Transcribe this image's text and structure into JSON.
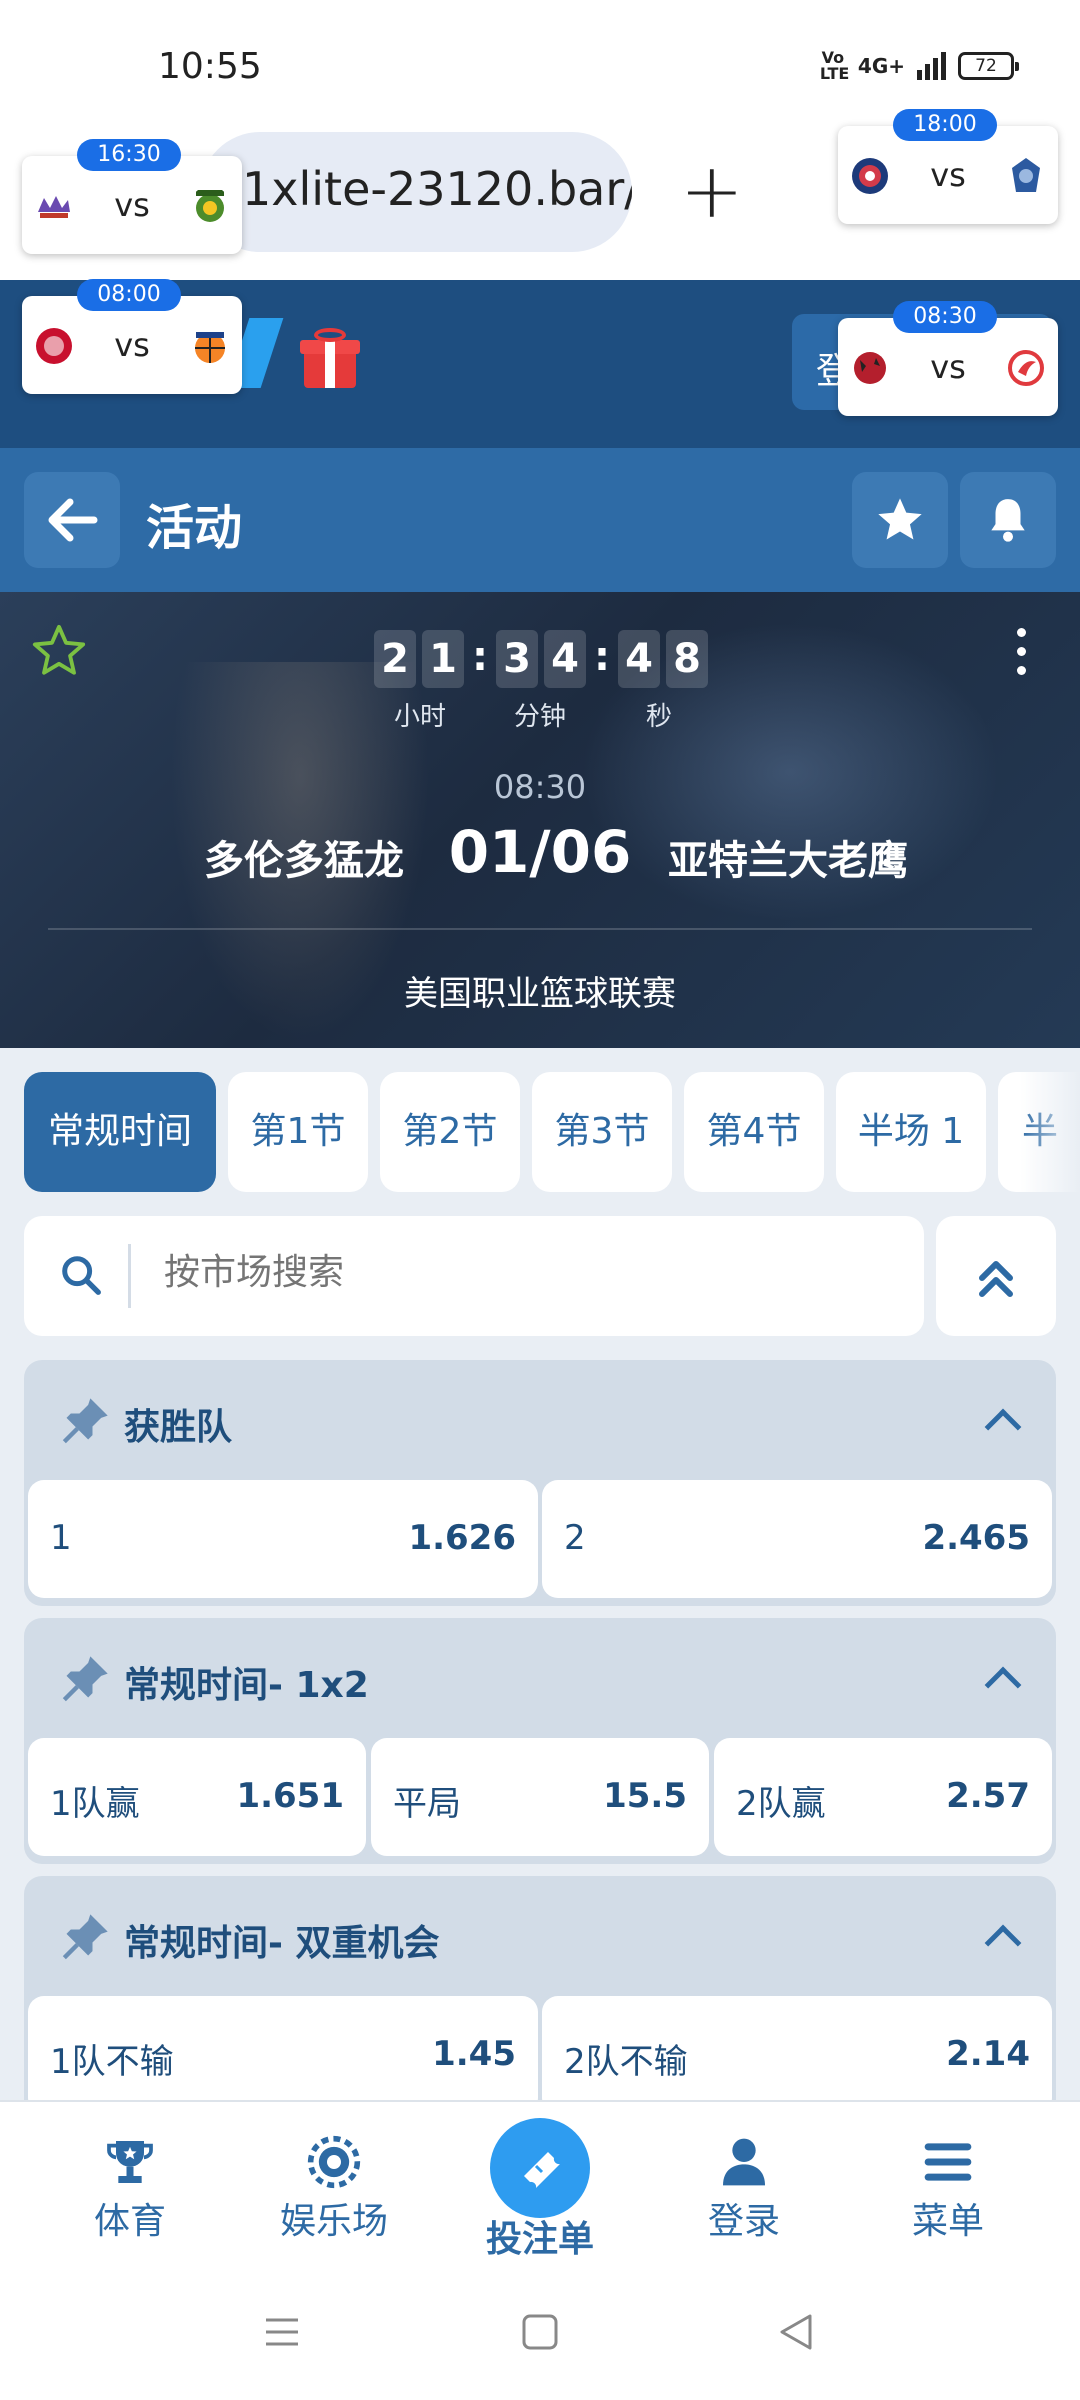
{
  "status_bar": {
    "time": "10:55",
    "volte": "Vo LTE",
    "network": "4G+",
    "battery": "72"
  },
  "browser": {
    "url": "1xlite-23120.bar/",
    "new_tab_label": "+"
  },
  "header": {
    "login_label": "登"
  },
  "match_popups": [
    {
      "time": "16:30",
      "vs": "vs",
      "home_logo": "sacramento-kings-logo",
      "away_logo": "phoenix-suns-logo"
    },
    {
      "time": "18:00",
      "vs": "vs",
      "home_logo": "team-logo-red-blue",
      "away_logo": "team-logo-blue"
    },
    {
      "time": "08:00",
      "vs": "vs",
      "home_logo": "team-logo-red",
      "away_logo": "new-york-knicks-logo"
    },
    {
      "time": "08:30",
      "vs": "vs",
      "home_logo": "toronto-raptors-logo",
      "away_logo": "atlanta-hawks-logo"
    }
  ],
  "activity_bar": {
    "title": "活动"
  },
  "scoreboard": {
    "countdown": {
      "hours": [
        "2",
        "1"
      ],
      "minutes": [
        "3",
        "4"
      ],
      "seconds": [
        "4",
        "8"
      ],
      "hours_label": "小时",
      "minutes_label": "分钟",
      "seconds_label": "秒"
    },
    "time": "08:30",
    "home_team": "多伦多猛龙",
    "date": "01/06",
    "away_team": "亚特兰大老鹰",
    "league": "美国职业篮球联赛"
  },
  "tabs": [
    {
      "label": "常规时间",
      "active": true
    },
    {
      "label": "第1节",
      "active": false
    },
    {
      "label": "第2节",
      "active": false
    },
    {
      "label": "第3节",
      "active": false
    },
    {
      "label": "第4节",
      "active": false
    },
    {
      "label": "半场 1",
      "active": false
    },
    {
      "label": "半",
      "active": false
    }
  ],
  "search": {
    "placeholder": "按市场搜索"
  },
  "markets": [
    {
      "title": "获胜队",
      "odds": [
        {
          "label": "1",
          "value": "1.626"
        },
        {
          "label": "2",
          "value": "2.465"
        }
      ]
    },
    {
      "title": "常规时间- 1x2",
      "odds": [
        {
          "label": "1队赢",
          "value": "1.651"
        },
        {
          "label": "平局",
          "value": "15.5"
        },
        {
          "label": "2队赢",
          "value": "2.57"
        }
      ]
    },
    {
      "title": "常规时间- 双重机会",
      "odds": [
        {
          "label": "1队不输",
          "value": "1.45"
        },
        {
          "label": "2队不输",
          "value": "2.14"
        }
      ]
    }
  ],
  "bottom_nav": [
    {
      "label": "体育",
      "icon": "trophy-icon"
    },
    {
      "label": "娱乐场",
      "icon": "casino-chip-icon"
    },
    {
      "label": "投注单",
      "icon": "ticket-icon"
    },
    {
      "label": "登录",
      "icon": "user-icon"
    },
    {
      "label": "菜单",
      "icon": "menu-icon"
    }
  ],
  "colors": {
    "primary": "#2d6aa4",
    "header_dark": "#1e4e80",
    "betslip_accent": "#2e9cf0",
    "popup_time_badge": "#1a6ee6",
    "favorite_star": "#7bc142"
  }
}
